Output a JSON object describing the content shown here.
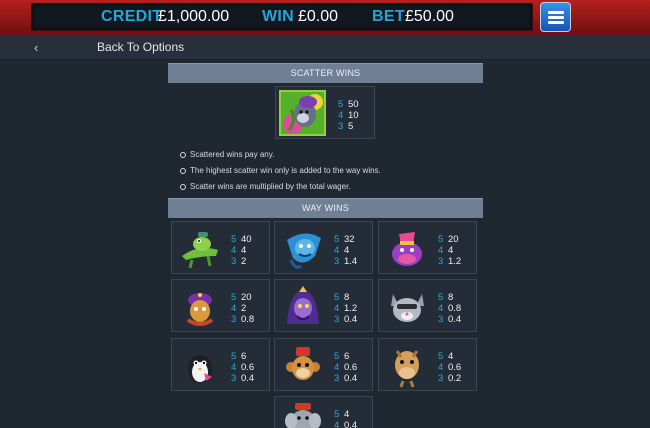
{
  "header": {
    "credit_label": "CREDIT",
    "credit_value": "£1,000.00",
    "win_label": "WIN",
    "win_value": "£0.00",
    "bet_label": "BET",
    "bet_value": "£50.00",
    "menu_icon": "hamburger-menu-icon"
  },
  "nav": {
    "back_label": "Back To Options",
    "back_icon": "chevron-left-icon"
  },
  "scatter": {
    "title": "SCATTER WINS",
    "symbol": "scatter-genie-monkey-icon",
    "pays": [
      {
        "count": "5",
        "value": "50"
      },
      {
        "count": "4",
        "value": "10"
      },
      {
        "count": "3",
        "value": "5"
      }
    ]
  },
  "notes": [
    "Scattered wins pay any.",
    "The highest scatter win only is added to the way wins.",
    "Scatter wins are multiplied by the total wager."
  ],
  "way_wins": {
    "title": "WAY WINS",
    "symbols": [
      {
        "name": "crocodile-icon",
        "pays": [
          {
            "count": "5",
            "value": "40"
          },
          {
            "count": "4",
            "value": "4"
          },
          {
            "count": "3",
            "value": "2"
          }
        ]
      },
      {
        "name": "blue-genie-icon",
        "pays": [
          {
            "count": "5",
            "value": "32"
          },
          {
            "count": "4",
            "value": "4"
          },
          {
            "count": "3",
            "value": "1.4"
          }
        ]
      },
      {
        "name": "purple-hippo-icon",
        "pays": [
          {
            "count": "5",
            "value": "20"
          },
          {
            "count": "4",
            "value": "4"
          },
          {
            "count": "3",
            "value": "1.2"
          }
        ]
      },
      {
        "name": "camel-rider-icon",
        "pays": [
          {
            "count": "5",
            "value": "20"
          },
          {
            "count": "4",
            "value": "2"
          },
          {
            "count": "3",
            "value": "0.8"
          }
        ]
      },
      {
        "name": "purple-sorcerer-icon",
        "pays": [
          {
            "count": "5",
            "value": "8"
          },
          {
            "count": "4",
            "value": "1.2"
          },
          {
            "count": "3",
            "value": "0.4"
          }
        ]
      },
      {
        "name": "grey-cat-icon",
        "pays": [
          {
            "count": "5",
            "value": "8"
          },
          {
            "count": "4",
            "value": "0.8"
          },
          {
            "count": "3",
            "value": "0.4"
          }
        ]
      },
      {
        "name": "penguin-icon",
        "pays": [
          {
            "count": "5",
            "value": "6"
          },
          {
            "count": "4",
            "value": "0.6"
          },
          {
            "count": "3",
            "value": "0.4"
          }
        ]
      },
      {
        "name": "monkey-fez-icon",
        "pays": [
          {
            "count": "5",
            "value": "6"
          },
          {
            "count": "4",
            "value": "0.6"
          },
          {
            "count": "3",
            "value": "0.4"
          }
        ]
      },
      {
        "name": "camel-icon",
        "pays": [
          {
            "count": "5",
            "value": "4"
          },
          {
            "count": "4",
            "value": "0.6"
          },
          {
            "count": "3",
            "value": "0.2"
          }
        ]
      },
      {
        "name": "elephant-icon",
        "pays": [
          {
            "count": "5",
            "value": "4"
          },
          {
            "count": "4",
            "value": "0.4"
          }
        ]
      }
    ]
  }
}
